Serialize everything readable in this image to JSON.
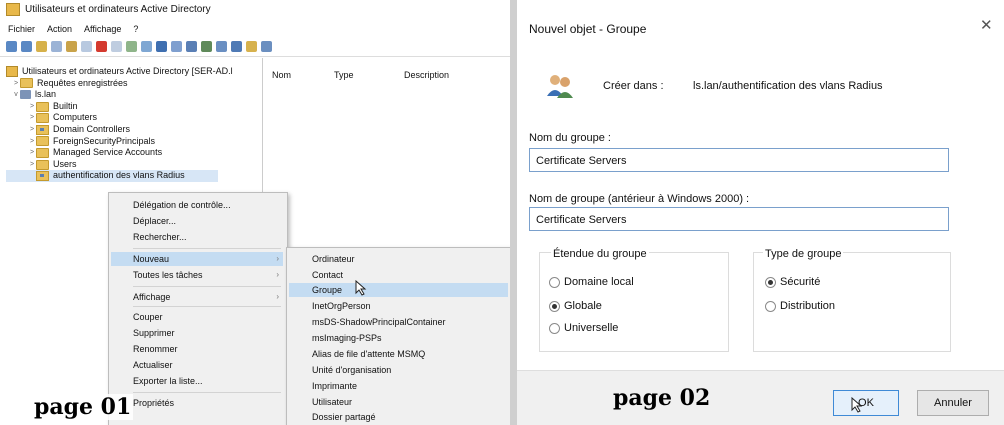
{
  "left_window": {
    "title": "Utilisateurs et ordinateurs Active Directory",
    "menu": [
      "Fichier",
      "Action",
      "Affichage",
      "?"
    ],
    "tree": [
      {
        "label": "Utilisateurs et ordinateurs Active Directory [SER-AD.l",
        "icon": "ad-console-icon",
        "expander": ""
      },
      {
        "label": "Requêtes enregistrées",
        "icon": "folder-icon",
        "expander": ">"
      },
      {
        "label": "ls.lan",
        "icon": "domain-icon",
        "expander": "v"
      },
      {
        "label": "Builtin",
        "icon": "folder-icon",
        "expander": ">"
      },
      {
        "label": "Computers",
        "icon": "folder-icon",
        "expander": ">"
      },
      {
        "label": "Domain Controllers",
        "icon": "ou-icon",
        "expander": ">"
      },
      {
        "label": "ForeignSecurityPrincipals",
        "icon": "folder-icon",
        "expander": ">"
      },
      {
        "label": "Managed Service Accounts",
        "icon": "folder-icon",
        "expander": ">"
      },
      {
        "label": "Users",
        "icon": "folder-icon",
        "expander": ">"
      },
      {
        "label": "authentification des vlans Radius",
        "icon": "ou-icon",
        "expander": ""
      }
    ],
    "columns": [
      "Nom",
      "Type",
      "Description"
    ],
    "context_menu": [
      "Délégation de contrôle...",
      "Déplacer...",
      "Rechercher...",
      "Nouveau",
      "Toutes les tâches",
      "Affichage",
      "Couper",
      "Supprimer",
      "Renommer",
      "Actualiser",
      "Exporter la liste...",
      "Propriétés"
    ],
    "submenu": [
      "Ordinateur",
      "Contact",
      "Groupe",
      "InetOrgPerson",
      "msDS-ShadowPrincipalContainer",
      "msImaging-PSPs",
      "Alias de file d'attente MSMQ",
      "Unité d'organisation",
      "Imprimante",
      "Utilisateur",
      "Dossier partagé"
    ],
    "page_label": "page 01"
  },
  "dialog": {
    "title": "Nouvel objet - Groupe",
    "create_in_label": "Créer dans :",
    "create_in_value": "ls.lan/authentification des vlans Radius",
    "group_name_label": "Nom du groupe :",
    "group_name_value": "Certificate Servers",
    "group_name_pre2000_label": "Nom de groupe (antérieur à Windows 2000) :",
    "group_name_pre2000_value": "Certificate Servers",
    "scope_title": "Étendue du groupe",
    "scope_options": [
      "Domaine local",
      "Globale",
      "Universelle"
    ],
    "scope_selected": "Globale",
    "type_title": "Type de groupe",
    "type_options": [
      "Sécurité",
      "Distribution"
    ],
    "type_selected": "Sécurité",
    "ok_label": "OK",
    "cancel_label": "Annuler",
    "page_label": "page 02"
  }
}
